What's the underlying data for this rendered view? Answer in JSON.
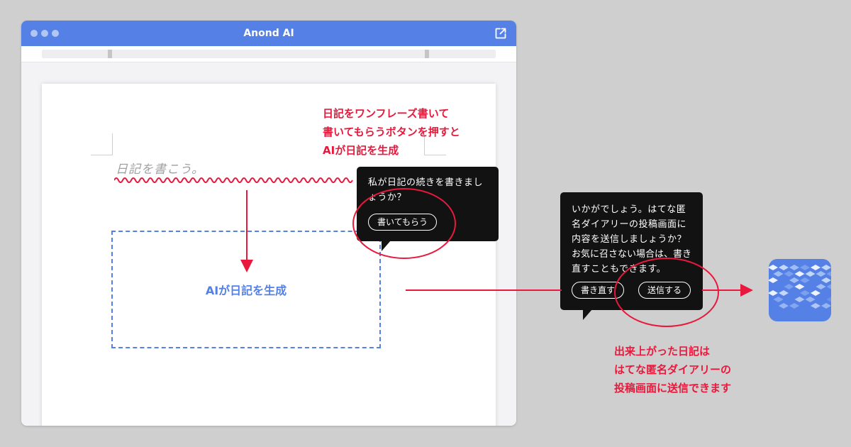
{
  "window": {
    "title": "Anond AI"
  },
  "editor": {
    "placeholder": "日記を書こう。",
    "generated_label": "AIが日記を生成"
  },
  "annotations": {
    "top_lines": [
      "日記をワンフレーズ書いて",
      "書いてもらうボタンを押すと",
      "AIが日記を生成"
    ],
    "bottom_lines": [
      "出来上がった日記は",
      "はてな匿名ダイアリーの",
      "投稿画面に送信できます"
    ]
  },
  "ai_bubble": {
    "lines": [
      "私が日記の続きを書きまし",
      "ょうか？"
    ],
    "button_label": "書いてもらう"
  },
  "send_bubble": {
    "lines": [
      "いかがでしょう。はてな匿",
      "名ダイアリーの投稿画面に",
      "内容を送信しましょうか？",
      "お気に召さない場合は、書き",
      "直すこともできます。"
    ],
    "rewrite_label": "書き直す",
    "send_label": "送信する"
  },
  "icons": {
    "open": "external-link-icon",
    "destination": "hatena-anonymous-diary-logo"
  },
  "colors": {
    "accent_blue": "#5580e6",
    "annotation_red": "#e8193c",
    "bubble_bg": "#121212",
    "background": "#cfcfcf"
  }
}
